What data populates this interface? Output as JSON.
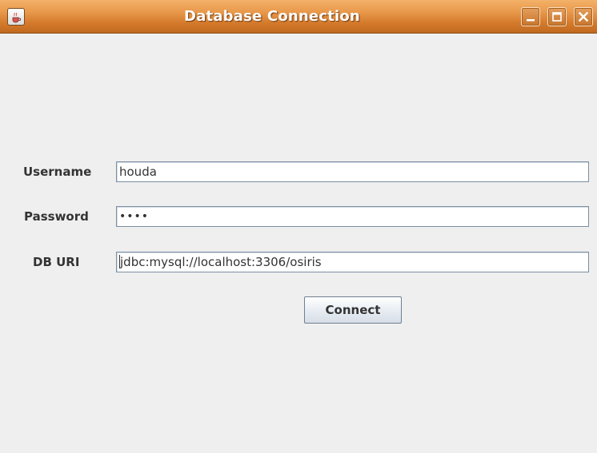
{
  "window": {
    "title": "Database Connection",
    "icons": {
      "app": "java-cup-icon",
      "minimize": "minimize-icon",
      "maximize": "maximize-icon",
      "close": "close-icon"
    },
    "titlebar_color": "#e0893a"
  },
  "form": {
    "username_label": "Username",
    "username_value": "houda",
    "password_label": "Password",
    "password_value": "••••",
    "dburi_label": "DB URI",
    "dburi_value": "jdbc:mysql://localhost:3306/osiris",
    "connect_label": "Connect"
  }
}
